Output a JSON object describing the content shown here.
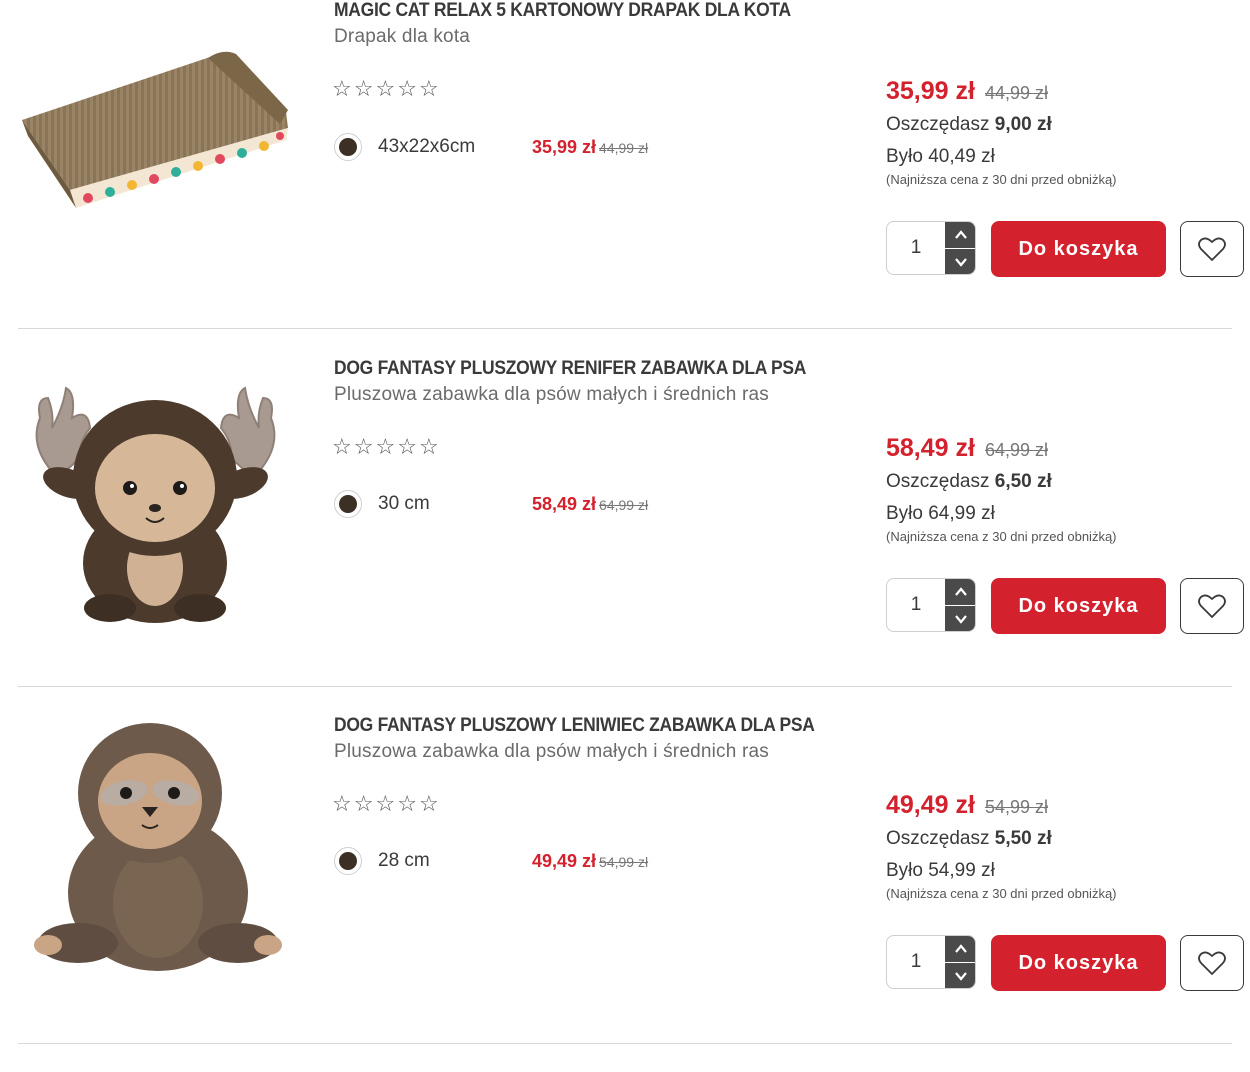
{
  "products": [
    {
      "title": "MAGIC CAT RELAX 5 KARTONOWY DRAPAK DLA KOTA",
      "subtitle": "Drapak dla kota",
      "rating_stars": "☆☆☆☆☆",
      "variant_label": "43x22x6cm",
      "variant_price": "35,99 zł",
      "variant_old_price": "44,99 zł",
      "price": "35,99 zł",
      "old_price": "44,99 zł",
      "save_label": "Oszczędasz",
      "save_amount": "9,00 zł",
      "was_label": "Było 40,49 zł",
      "lowest_note": "(Najniższa cena z 30 dni przed obniżką)",
      "quantity": "1",
      "cart_label": "Do koszyka",
      "image_icon": "cat-scratcher-image"
    },
    {
      "title": "DOG FANTASY PLUSZOWY RENIFER ZABAWKA DLA PSA",
      "subtitle": "Pluszowa zabawka dla psów małych i średnich ras",
      "rating_stars": "☆☆☆☆☆",
      "variant_label": "30 cm",
      "variant_price": "58,49 zł",
      "variant_old_price": "64,99 zł",
      "price": "58,49 zł",
      "old_price": "64,99 zł",
      "save_label": "Oszczędasz",
      "save_amount": "6,50 zł",
      "was_label": "Było 64,99 zł",
      "lowest_note": "(Najniższa cena z 30 dni przed obniżką)",
      "quantity": "1",
      "cart_label": "Do koszyka",
      "image_icon": "plush-reindeer-image"
    },
    {
      "title": "DOG FANTASY PLUSZOWY LENIWIEC ZABAWKA DLA PSA",
      "subtitle": "Pluszowa zabawka dla psów małych i średnich ras",
      "rating_stars": "☆☆☆☆☆",
      "variant_label": "28 cm",
      "variant_price": "49,49 zł",
      "variant_old_price": "54,99 zł",
      "price": "49,49 zł",
      "old_price": "54,99 zł",
      "save_label": "Oszczędasz",
      "save_amount": "5,50 zł",
      "was_label": "Było 54,99 zł",
      "lowest_note": "(Najniższa cena z 30 dni przed obniżką)",
      "quantity": "1",
      "cart_label": "Do koszyka",
      "image_icon": "plush-sloth-image"
    }
  ],
  "colors": {
    "accent_red": "#d3212d",
    "swatch_brown": "#3c2f23",
    "stepper_dark": "#4a4a4a"
  }
}
